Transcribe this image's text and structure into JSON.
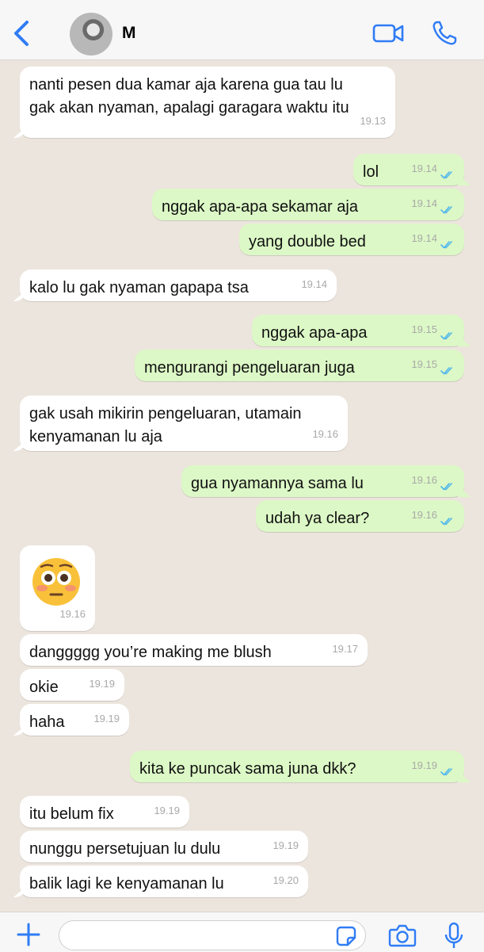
{
  "header": {
    "contact_name": "M"
  },
  "messages": [
    {
      "side": "in",
      "text": "nanti pesen dua kamar aja karena gua tau lu\ngak akan nyaman, apalagi garagara waktu itu",
      "time": "19.13"
    },
    {
      "side": "out",
      "text": "lol",
      "time": "19.14",
      "status": "read"
    },
    {
      "side": "out",
      "text": "nggak apa-apa sekamar aja",
      "time": "19.14",
      "status": "read"
    },
    {
      "side": "out",
      "text": "yang double bed",
      "time": "19.14",
      "status": "read"
    },
    {
      "side": "in",
      "text": "kalo lu gak nyaman gapapa tsa",
      "time": "19.14"
    },
    {
      "side": "out",
      "text": "nggak apa-apa",
      "time": "19.15",
      "status": "read"
    },
    {
      "side": "out",
      "text": "mengurangi pengeluaran juga",
      "time": "19.15",
      "status": "read"
    },
    {
      "side": "in",
      "text": "gak usah mikirin pengeluaran, utamain\nkenyamanan lu aja",
      "time": "19.16"
    },
    {
      "side": "out",
      "text": "gua nyamannya sama lu",
      "time": "19.16",
      "status": "read"
    },
    {
      "side": "out",
      "text": "udah ya clear?",
      "time": "19.16",
      "status": "read"
    },
    {
      "side": "in",
      "emoji": "flushed-face",
      "time": "19.16"
    },
    {
      "side": "in",
      "text": "danggggg you’re making me blush",
      "time": "19.17"
    },
    {
      "side": "in",
      "text": "okie",
      "time": "19.19"
    },
    {
      "side": "in",
      "text": "haha",
      "time": "19.19"
    },
    {
      "side": "out",
      "text": "kita ke puncak sama juna dkk?",
      "time": "19.19",
      "status": "read"
    },
    {
      "side": "in",
      "text": "itu belum fix",
      "time": "19.19"
    },
    {
      "side": "in",
      "text": "nunggu persetujuan lu dulu",
      "time": "19.19"
    },
    {
      "side": "in",
      "text": "balik lagi ke kenyamanan lu",
      "time": "19.20"
    }
  ],
  "input": {
    "placeholder": ""
  },
  "colors": {
    "accent": "#2f7cf6",
    "incoming_bubble": "#ffffff",
    "outgoing_bubble": "#dcf8c6",
    "background": "#ece5dd",
    "read_ticks": "#4fb6ec"
  },
  "icons": [
    "back-chevron-icon",
    "video-call-icon",
    "phone-call-icon",
    "plus-icon",
    "sticker-icon",
    "camera-icon",
    "microphone-icon"
  ]
}
